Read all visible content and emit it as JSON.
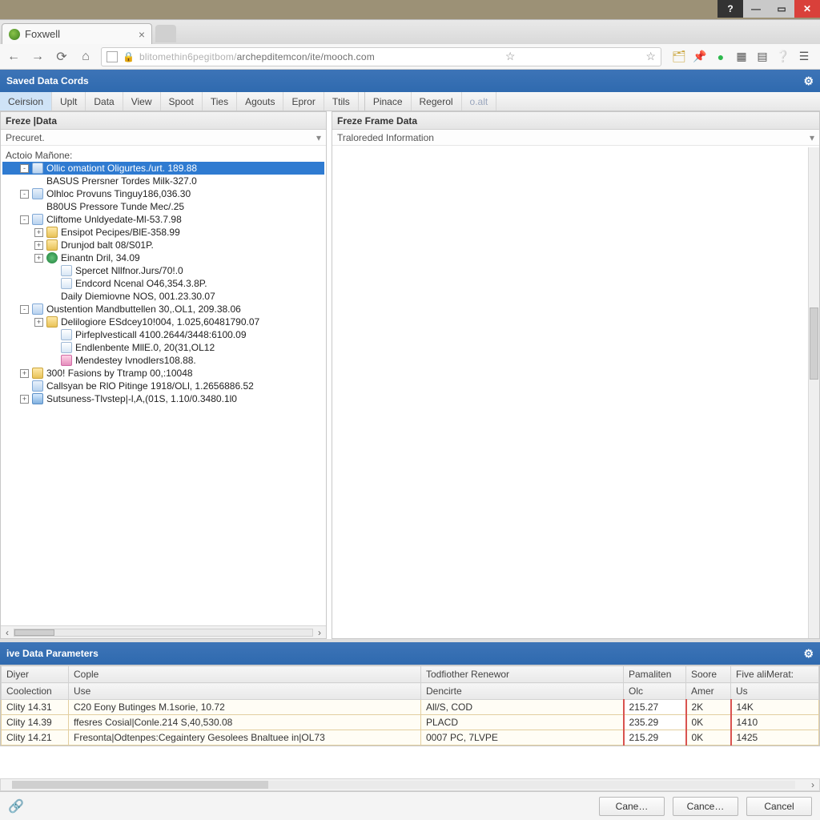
{
  "titlebar": {
    "help": "?",
    "min": "—",
    "max": "▭",
    "close": "✕"
  },
  "browser": {
    "tab_title": "Foxwell",
    "url_grey": "blitomethin6pegitbom/",
    "url_dark": "archepditemcon/ite/mooch.com"
  },
  "app": {
    "header": "Saved Data Cords",
    "menu": [
      "Ceirsion",
      "Uplt",
      "Data",
      "View",
      "Spoot",
      "Ties",
      "Agouts",
      "Epror",
      "Ttils"
    ],
    "menu2": [
      "Pinace",
      "Regerol"
    ],
    "menu_dim": "o.alt"
  },
  "left_pane": {
    "title": "Freze |Data",
    "sub": "Precuret.",
    "group": "Actoio Mañone:",
    "tree": [
      {
        "d": 1,
        "t": "-",
        "ic": "page",
        "lbl": "Ollic omationt Oligurtes./urt. 189.88",
        "sel": true
      },
      {
        "d": 2,
        "t": "",
        "ic": "",
        "lbl": "BASUS Prersner Tordes Milk-327.0"
      },
      {
        "d": 1,
        "t": "-",
        "ic": "page",
        "lbl": "Olhloc Provuns Tinguy186,036.30"
      },
      {
        "d": 2,
        "t": "",
        "ic": "",
        "lbl": "B80US Pressore Tunde Mec/.25"
      },
      {
        "d": 1,
        "t": "-",
        "ic": "page",
        "lbl": "Cliftome Unldyedate-Ml-53.7.98"
      },
      {
        "d": 2,
        "t": "+",
        "ic": "fold",
        "lbl": "Ensipot Pecipes/BlE-358.99"
      },
      {
        "d": 2,
        "t": "+",
        "ic": "fold",
        "lbl": "Drunjod balt 08/S01P."
      },
      {
        "d": 2,
        "t": "+",
        "ic": "globe",
        "lbl": "Einantn Dril, 34.09"
      },
      {
        "d": 3,
        "t": "",
        "ic": "doc",
        "lbl": "Spercet Nllfnor.Jurs/70!.0"
      },
      {
        "d": 3,
        "t": "",
        "ic": "doc",
        "lbl": "Endcord Ncenal O46,354.3.8P."
      },
      {
        "d": 3,
        "t": "",
        "ic": "",
        "lbl": "Daily Diemiovne NOS, 001.23.30.07"
      },
      {
        "d": 1,
        "t": "-",
        "ic": "page",
        "lbl": "Oustention Mandbuttellen 30,.OL1, 209.38.06"
      },
      {
        "d": 2,
        "t": "+",
        "ic": "fold",
        "lbl": "Delilogiore ESdcey10!004, 1.025,60481790.07"
      },
      {
        "d": 3,
        "t": "",
        "ic": "doc",
        "lbl": "Pirfeplvesticall 4100.2644/3448:6100.09"
      },
      {
        "d": 3,
        "t": "",
        "ic": "doc",
        "lbl": "Endlenbente MllE.0, 20(31,OL12"
      },
      {
        "d": 3,
        "t": "",
        "ic": "pink",
        "lbl": "Mendestey Ivnodlers108.88."
      },
      {
        "d": 1,
        "t": "+",
        "ic": "fold",
        "lbl": "300! Fasions by Ttramp 00,:10048"
      },
      {
        "d": 1,
        "t": "",
        "ic": "page",
        "lbl": "Callsyan be RlO Pitinge 1918/OLl, 1.2656886.52"
      },
      {
        "d": 1,
        "t": "+",
        "ic": "in",
        "lbl": "Sutsuness-Tlvstep|-l,A,(01S, 1.10/0.3480.1l0"
      }
    ]
  },
  "right_pane": {
    "title": "Freze Frame Data",
    "sub": "Traloreded Information"
  },
  "live": {
    "header": "ive Data Parameters",
    "cols1": [
      "Diyer",
      "Cople"
    ],
    "cols2": [
      "Todfiother Renewor",
      "Pamaliten",
      "Soore",
      "Five aliMerat:"
    ],
    "subcols1": [
      "Coolection",
      "Use"
    ],
    "subcols2": [
      "Dencirte",
      "Olc",
      "Amer",
      "Us"
    ],
    "rows": [
      {
        "c1": "Clity 14.31",
        "c2": "C20 Eony Butinges M.1sorie, 10.72",
        "c3": "All/S, COD",
        "c4": "215.27",
        "c5": "2K",
        "c6": "14K"
      },
      {
        "c1": "Clity 14.39",
        "c2": "ffesres Cosial|Conle.214 S,40,530.08",
        "c3": "PLACD",
        "c4": "235.29",
        "c5": "0K",
        "c6": "1410"
      },
      {
        "c1": "Clity 14.21",
        "c2": "Fresonta|Odtenpes:Cegaintery Gesolees Bnaltuee in|OL73",
        "c3": "0007 PC, 7LVPE",
        "c4": "215.29",
        "c5": "0K",
        "c6": "1425"
      }
    ]
  },
  "footer": {
    "b1": "Cane…",
    "b2": "Cance…",
    "b3": "Cancel"
  }
}
